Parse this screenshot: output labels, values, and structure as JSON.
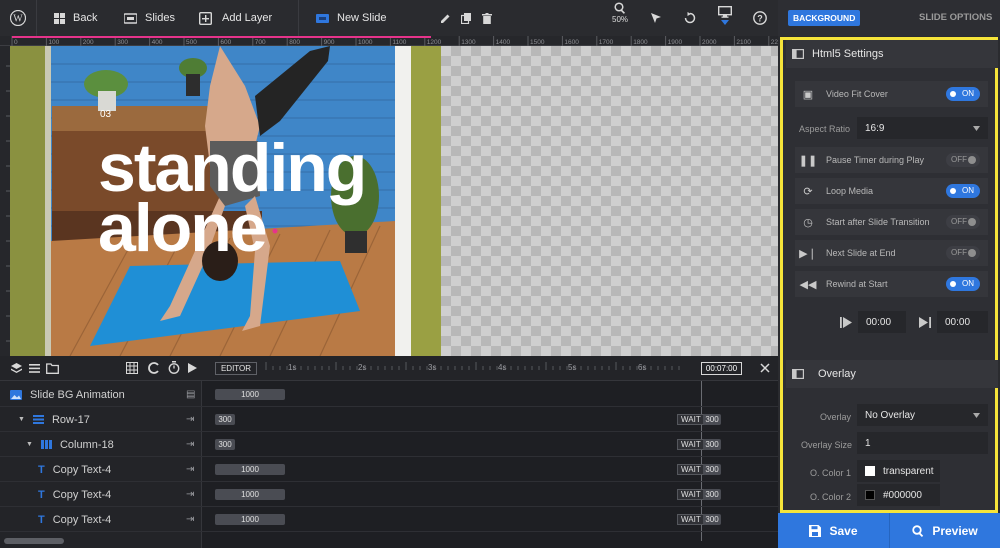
{
  "toolbar": {
    "back": "Back",
    "slides": "Slides",
    "add_layer": "Add Layer",
    "new_slide": "New Slide",
    "zoom": "50%"
  },
  "ruler_ticks": [
    "0",
    "100",
    "200",
    "300",
    "400",
    "500",
    "600",
    "700",
    "800",
    "900",
    "1000",
    "1100",
    "1200",
    "1300",
    "1400",
    "1500",
    "1600",
    "1700",
    "1800",
    "1900",
    "2000",
    "2100",
    "2200",
    "2300",
    "2400",
    "2500"
  ],
  "slide": {
    "number": "03",
    "line1": "standing",
    "line2": "alone"
  },
  "timeline": {
    "editor_label": "EDITOR",
    "time_marks": [
      "1s",
      "2s",
      "3s",
      "4s",
      "5s",
      "6s"
    ],
    "end_time": "00:07:00",
    "rows": [
      {
        "label": "Slide BG Animation",
        "pill": "1000",
        "wait": ""
      },
      {
        "label": "Row-17",
        "pill": "300",
        "wait": "WAIT",
        "wait_value": "300"
      },
      {
        "label": "Column-18",
        "pill": "300",
        "wait": "WAIT",
        "wait_value": "300"
      },
      {
        "label": "Copy Text-4",
        "pill": "1000",
        "wait": "WAIT",
        "wait_value": "300"
      },
      {
        "label": "Copy Text-4",
        "pill": "1000",
        "wait": "WAIT",
        "wait_value": "300"
      },
      {
        "label": "Copy Text-4",
        "pill": "1000",
        "wait": "WAIT",
        "wait_value": "300"
      }
    ]
  },
  "sidebar": {
    "tab_background": "BACKGROUND",
    "tab_slide_options": "SLIDE OPTIONS",
    "html5_title": "Html5 Settings",
    "video_fit_cover": "Video Fit Cover",
    "video_fit_cover_state": "ON",
    "aspect_ratio_label": "Aspect Ratio",
    "aspect_ratio_value": "16:9",
    "pause_timer": "Pause Timer during Play",
    "pause_timer_state": "OFF",
    "loop_media": "Loop Media",
    "loop_media_state": "ON",
    "start_after": "Start after Slide Transition",
    "start_after_state": "OFF",
    "next_slide": "Next Slide at End",
    "next_slide_state": "OFF",
    "rewind": "Rewind at Start",
    "rewind_state": "ON",
    "start_time": "00:00",
    "end_time": "00:00",
    "overlay_title": "Overlay",
    "overlay_label": "Overlay",
    "overlay_value": "No Overlay",
    "overlay_size_label": "Overlay Size",
    "overlay_size_value": "1",
    "color1_label": "O. Color 1",
    "color1_value": "transparent",
    "color2_label": "O. Color 2",
    "color2_value": "#000000",
    "save": "Save",
    "preview": "Preview"
  },
  "colors": {
    "accent": "#2f77de",
    "highlight": "#f6e43a"
  }
}
